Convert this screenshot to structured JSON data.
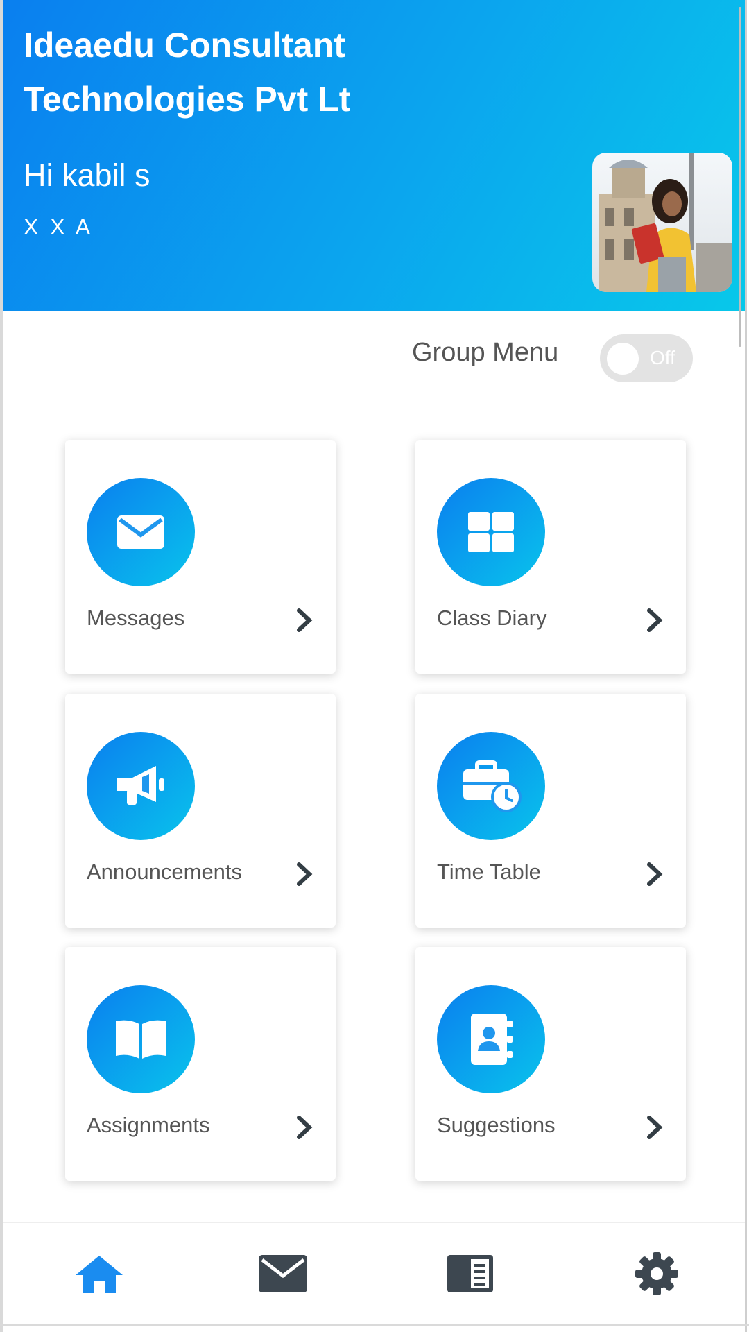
{
  "header": {
    "org_name": "Ideaedu Consultant Technologies Pvt Lt",
    "greeting": "Hi kabil s",
    "class_label": "X X A"
  },
  "group_menu": {
    "label": "Group Menu",
    "toggle_state": "Off",
    "enabled": false
  },
  "cards": [
    {
      "label": "Messages",
      "icon": "envelope-icon"
    },
    {
      "label": "Class Diary",
      "icon": "grid-icon"
    },
    {
      "label": "Announcements",
      "icon": "megaphone-icon"
    },
    {
      "label": "Time Table",
      "icon": "briefcase-clock-icon"
    },
    {
      "label": "Assignments",
      "icon": "open-book-icon"
    },
    {
      "label": "Suggestions",
      "icon": "contact-book-icon"
    }
  ],
  "bottom_nav": [
    {
      "icon": "home-icon",
      "active": true
    },
    {
      "icon": "mail-icon",
      "active": false
    },
    {
      "icon": "book-list-icon",
      "active": false
    },
    {
      "icon": "gear-icon",
      "active": false
    }
  ],
  "colors": {
    "header_gradient_start": "#0a7fef",
    "header_gradient_end": "#08c8ea",
    "active_nav": "#1a8cf0",
    "inactive_nav": "#3d4750",
    "card_label": "#555555"
  }
}
